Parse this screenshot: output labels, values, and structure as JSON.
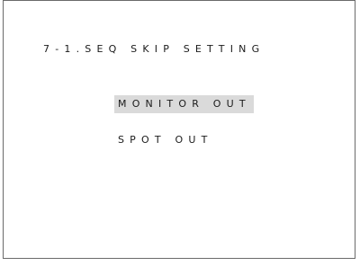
{
  "screen": {
    "title": "7-1.SEQ SKIP SETTING",
    "menu_items": [
      {
        "label": "MONITOR OUT",
        "selected": true
      },
      {
        "label": "SPOT OUT",
        "selected": false
      }
    ],
    "colors": {
      "highlight": "#dadada",
      "text": "#1a1a1a",
      "border": "#6a6a6a"
    }
  }
}
